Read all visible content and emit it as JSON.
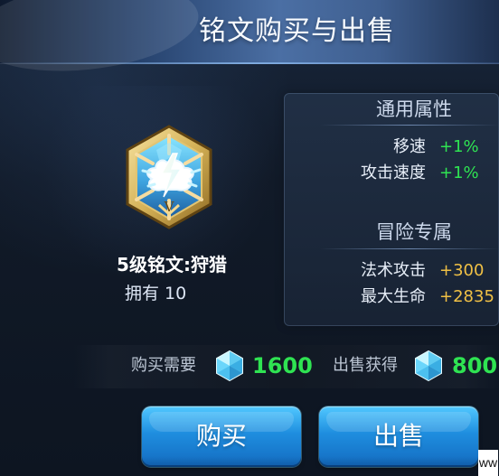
{
  "header": {
    "title": "铭文购买与出售"
  },
  "rune": {
    "name": "5级铭文:狩猎",
    "owned_label": "拥有",
    "owned_count": "10",
    "icon": "hexagonal-lightning-rune-icon"
  },
  "attributes": {
    "general_title": "通用属性",
    "general_stats": [
      {
        "label": "移速",
        "value": "+1%"
      },
      {
        "label": "攻击速度",
        "value": "+1%"
      }
    ],
    "adventure_title": "冒险专属",
    "adventure_stats": [
      {
        "label": "法术攻击",
        "value": "+300"
      },
      {
        "label": "最大生命",
        "value": "+2835"
      }
    ]
  },
  "pricing": {
    "buy_label": "购买需要",
    "buy_value": "1600",
    "sell_label": "出售获得",
    "sell_value": "800",
    "currency_icon": "crystal-icon"
  },
  "actions": {
    "buy": "购买",
    "sell": "出售"
  },
  "watermark": {
    "text": "ww"
  },
  "colors": {
    "green": "#2fe352",
    "gold": "#f0c045",
    "button_blue": "#1f8edf",
    "header_blue": "#4b6fa4"
  }
}
